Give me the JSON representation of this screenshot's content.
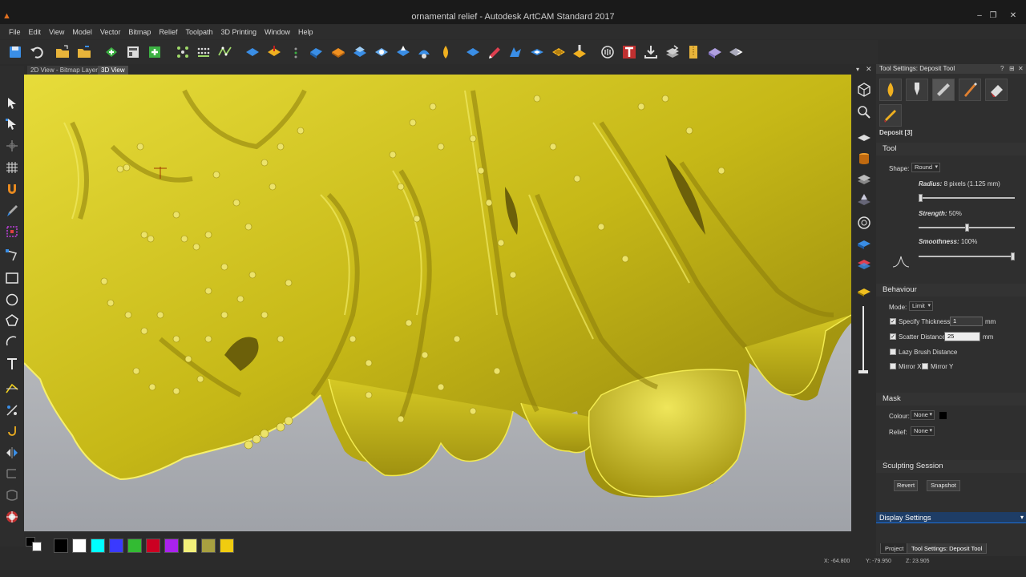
{
  "window": {
    "title": "ornamental relief - Autodesk ArtCAM Standard 2017"
  },
  "menu": [
    "File",
    "Edit",
    "View",
    "Model",
    "Vector",
    "Bitmap",
    "Relief",
    "Toolpath",
    "3D Printing",
    "Window",
    "Help"
  ],
  "viewport_tabs": [
    "2D View - Bitmap Layer",
    "3D View"
  ],
  "panel": {
    "title": "Tool Settings: Deposit Tool",
    "tool_name": "Deposit [3]",
    "tool_section": "Tool",
    "shape_label": "Shape:",
    "shape_value": "Round",
    "radius_label": "Radius:",
    "radius_value": "8 pixels (1.125 mm)",
    "strength_label": "Strength:",
    "strength_value": "50%",
    "strength_fraction": 0.5,
    "smoothness_label": "Smoothness:",
    "smoothness_value": "100%",
    "smoothness_fraction": 1.0,
    "radius_fraction": 0.0,
    "behaviour_section": "Behaviour",
    "mode_label": "Mode:",
    "mode_value": "Limit",
    "specify_thickness_label": "Specify Thickness",
    "specify_thickness_value": "1",
    "specify_thickness_unit": "mm",
    "scatter_distance_label": "Scatter Distance",
    "scatter_distance_value": "25",
    "scatter_distance_unit": "mm",
    "lazy_brush_label": "Lazy Brush Distance",
    "mirror_x_label": "Mirror X",
    "mirror_y_label": "Mirror Y",
    "mask_section": "Mask",
    "colour_label": "Colour:",
    "colour_value": "None",
    "relief_label": "Relief:",
    "relief_value": "None",
    "sculpting_section": "Sculpting Session",
    "revert_label": "Revert",
    "snapshot_label": "Snapshot",
    "display_settings_label": "Display Settings",
    "bottom_tabs": [
      "Project",
      "Tool Settings: Deposit Tool"
    ]
  },
  "status": {
    "x": "X: -64.800",
    "y": "Y: -79.950",
    "z": "Z: 23.905"
  },
  "palette_colors": [
    "#000000",
    "#ffffff",
    "#00ffff",
    "#3a3aff",
    "#33bb33",
    "#cc0022",
    "#aa22ee",
    "#f2f07a",
    "#a8a040",
    "#f0cc10"
  ],
  "accent_color": "#1e6fd9",
  "relief_color": "#d9c81e"
}
